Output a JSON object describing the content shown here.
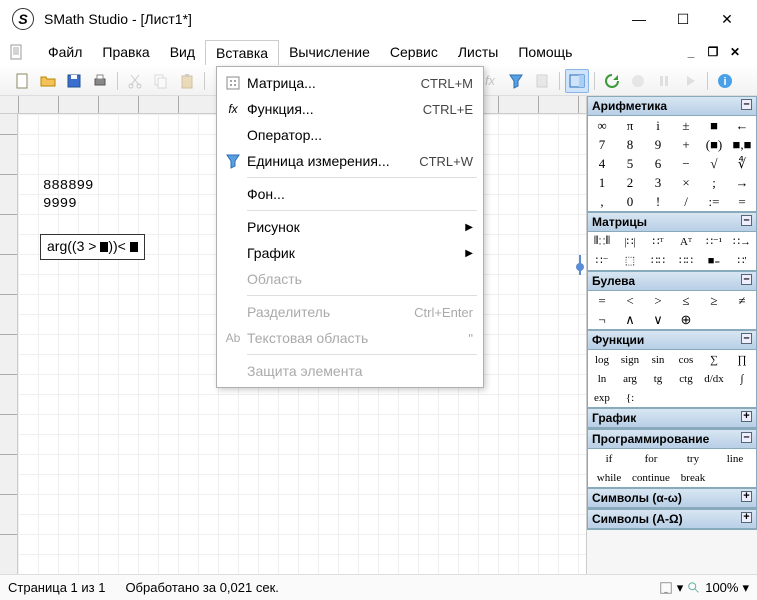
{
  "window": {
    "title": "SMath Studio - [Лист1*]"
  },
  "menu": {
    "items": [
      "Файл",
      "Правка",
      "Вид",
      "Вставка",
      "Вычисление",
      "Сервис",
      "Листы",
      "Помощь"
    ],
    "activeIndex": 3
  },
  "dropdown": {
    "items": [
      {
        "label": "Матрица...",
        "shortcut": "CTRL+M",
        "icon": "matrix"
      },
      {
        "label": "Функция...",
        "shortcut": "CTRL+E",
        "icon": "fx"
      },
      {
        "label": "Оператор...",
        "shortcut": "",
        "icon": ""
      },
      {
        "label": "Единица измерения...",
        "shortcut": "CTRL+W",
        "icon": "funnel"
      },
      {
        "sep": true
      },
      {
        "label": "Фон...",
        "shortcut": "",
        "icon": ""
      },
      {
        "sep": true
      },
      {
        "label": "Рисунок",
        "sub": true
      },
      {
        "label": "График",
        "sub": true
      },
      {
        "label": "Область",
        "disabled": true
      },
      {
        "sep": true
      },
      {
        "label": "Разделитель",
        "shortcut": "Ctrl+Enter",
        "disabled": true
      },
      {
        "label": "Текстовая область",
        "shortcut": "\"",
        "disabled": true,
        "iconlabel": "Ab"
      },
      {
        "sep": true
      },
      {
        "label": "Защита элемента",
        "disabled": true
      }
    ]
  },
  "canvas": {
    "text1": "888899",
    "text2": "9999",
    "formula_prefix": "arg",
    "formula_open": "(",
    "formula_expr1": "(3 > ",
    "formula_expr2": ")",
    "formula_close": ")",
    "formula_op": "< "
  },
  "gutter": {
    "fx": "fx",
    "ab": "Aƅ"
  },
  "panels": {
    "arith": {
      "title": "Арифметика",
      "rows": [
        [
          "∞",
          "π",
          "i",
          "±",
          "■",
          "←"
        ],
        [
          "7",
          "8",
          "9",
          "+",
          "(■)",
          "■,■"
        ],
        [
          "4",
          "5",
          "6",
          "−",
          "√",
          "∜"
        ],
        [
          "1",
          "2",
          "3",
          "×",
          ";",
          "→"
        ],
        [
          ",",
          "0",
          "!",
          "/",
          ":=",
          "="
        ]
      ]
    },
    "matrix": {
      "title": "Матрицы",
      "rows": [
        [
          "⦀∷⦀",
          "|∷|",
          "∷ᵀ",
          "Aᵀ",
          "∷⁻¹",
          "∷→"
        ],
        [
          "∷⁻",
          "⬚",
          "∷∷",
          "∷∷",
          "■₌",
          "∷'"
        ]
      ]
    },
    "bool": {
      "title": "Булева",
      "rows": [
        [
          "=",
          "<",
          ">",
          "≤",
          "≥",
          "≠"
        ],
        [
          "¬",
          "∧",
          "∨",
          "⊕",
          "",
          ""
        ]
      ]
    },
    "func": {
      "title": "Функции",
      "rows": [
        [
          "log",
          "sign",
          "sin",
          "cos",
          "∑",
          "∏"
        ],
        [
          "ln",
          "arg",
          "tg",
          "ctg",
          "d/dx",
          "∫"
        ],
        [
          "exp",
          "{:",
          "",
          "",
          "",
          ""
        ]
      ]
    },
    "plot": {
      "title": "График"
    },
    "prog": {
      "title": "Программирование",
      "rows": [
        [
          "if",
          "for",
          "try",
          "line"
        ],
        [
          "while",
          "continue",
          "break",
          ""
        ]
      ]
    },
    "sym1": {
      "title": "Символы (α-ω)"
    },
    "sym2": {
      "title": "Символы (Α-Ω)"
    }
  },
  "status": {
    "page": "Страница 1 из 1",
    "time": "Обработано за 0,021 сек.",
    "zoom": "100%"
  }
}
